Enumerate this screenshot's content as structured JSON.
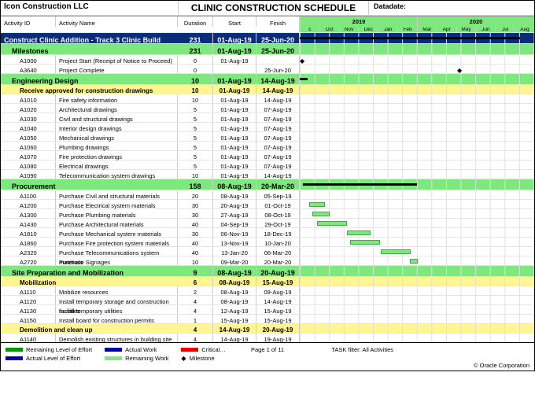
{
  "company": "Icon Construction LLC",
  "title": "CLINIC CONSTRUCTION SCHEDULE",
  "datadate_label": "Datadate:",
  "columns": {
    "id": "Activity ID",
    "name": "Activity Name",
    "dur": "Duration",
    "start": "Start",
    "finish": "Finish"
  },
  "years": [
    "2019",
    "2020"
  ],
  "months": [
    "c",
    "Oct",
    "Nov",
    "Dec",
    "Jan",
    "Feb",
    "Mar",
    "Apr",
    "May",
    "Jun",
    "Jul",
    "Aug"
  ],
  "footer": {
    "legend_remaining_loe": "Remaining Level of Effort",
    "legend_actual_loe": "Actual Level of Effort",
    "legend_actual_work": "Actual Work",
    "legend_remaining_work": "Remaining Work",
    "legend_critical": "Critical…",
    "legend_milestone": "Milestone",
    "page": "Page 1 of 11",
    "filter": "TASK filter: All Activities",
    "copyright": "© Oracle Corporation"
  },
  "rows": [
    {
      "type": "summary-top",
      "name": "Construct Clinic Addition - Track 3 Clinic Build",
      "dur": "231",
      "start": "01-Aug-19",
      "finish": "25-Jun-20",
      "sum": [
        0,
        280
      ]
    },
    {
      "type": "group",
      "name": "Milestones",
      "dur": "231",
      "start": "01-Aug-19",
      "finish": "25-Jun-20",
      "valcls": "cell-green"
    },
    {
      "type": "task",
      "id": "A1000",
      "name": "Project Start (Receipt of Notice to Proceed)",
      "dur": "0",
      "start": "01-Aug-19",
      "finish": "",
      "ms": 0
    },
    {
      "type": "task",
      "id": "A3640",
      "name": "Project Complete",
      "dur": "0",
      "start": "",
      "finish": "25-Jun-20",
      "ms": 200
    },
    {
      "type": "group",
      "name": "Engineering Design",
      "dur": "10",
      "start": "01-Aug-19",
      "finish": "14-Aug-19",
      "valcls": "cell-green",
      "sum": [
        0,
        10
      ]
    },
    {
      "type": "sub",
      "name": "Receive approved for construction drawings",
      "dur": "10",
      "start": "01-Aug-19",
      "finish": "14-Aug-19",
      "valcls": "cell-yellow"
    },
    {
      "type": "task",
      "id": "A1010",
      "name": "Fire safety information",
      "dur": "10",
      "start": "01-Aug-19",
      "finish": "14-Aug-19"
    },
    {
      "type": "task",
      "id": "A1020",
      "name": "Architectural drawings",
      "dur": "5",
      "start": "01-Aug-19",
      "finish": "07-Aug-19"
    },
    {
      "type": "task",
      "id": "A1030",
      "name": "Civil and structural drawings",
      "dur": "5",
      "start": "01-Aug-19",
      "finish": "07-Aug-19"
    },
    {
      "type": "task",
      "id": "A1040",
      "name": "Interior design drawings",
      "dur": "5",
      "start": "01-Aug-19",
      "finish": "07-Aug-19"
    },
    {
      "type": "task",
      "id": "A1050",
      "name": "Mechanical drawings",
      "dur": "5",
      "start": "01-Aug-19",
      "finish": "07-Aug-19"
    },
    {
      "type": "task",
      "id": "A1060",
      "name": "Plumbing drawings",
      "dur": "5",
      "start": "01-Aug-19",
      "finish": "07-Aug-19"
    },
    {
      "type": "task",
      "id": "A1070",
      "name": "Fire protection drawings",
      "dur": "5",
      "start": "01-Aug-19",
      "finish": "07-Aug-19"
    },
    {
      "type": "task",
      "id": "A1080",
      "name": "Electrical drawings",
      "dur": "5",
      "start": "01-Aug-19",
      "finish": "07-Aug-19"
    },
    {
      "type": "task",
      "id": "A1090",
      "name": "Telecommunication system drawings",
      "dur": "10",
      "start": "01-Aug-19",
      "finish": "14-Aug-19"
    },
    {
      "type": "group",
      "name": "Procurement",
      "dur": "158",
      "start": "08-Aug-19",
      "finish": "20-Mar-20",
      "valcls": "cell-green",
      "sum": [
        4,
        145
      ]
    },
    {
      "type": "task",
      "id": "A1100",
      "name": "Purchase Civil and structural materials",
      "dur": "20",
      "start": "08-Aug-19",
      "finish": "05-Sep-19"
    },
    {
      "type": "task",
      "id": "A1200",
      "name": "Purchase Electrical system materials",
      "dur": "30",
      "start": "20-Aug-19",
      "finish": "01-Oct-19",
      "bar": [
        12,
        20
      ]
    },
    {
      "type": "task",
      "id": "A1300",
      "name": "Purchase Plumbing materials",
      "dur": "30",
      "start": "27-Aug-19",
      "finish": "08-Oct-19",
      "bar": [
        16,
        22
      ]
    },
    {
      "type": "task",
      "id": "A1430",
      "name": "Purchase Architectural materials",
      "dur": "40",
      "start": "04-Sep-19",
      "finish": "29-Oct-19",
      "bar": [
        22,
        38
      ]
    },
    {
      "type": "task",
      "id": "A1810",
      "name": "Purchase Mechanical system materials",
      "dur": "30",
      "start": "06-Nov-19",
      "finish": "18-Dec-19",
      "bar": [
        60,
        30
      ]
    },
    {
      "type": "task",
      "id": "A1860",
      "name": "Purchase Fire protection system materials",
      "dur": "40",
      "start": "13-Nov-19",
      "finish": "10-Jan-20",
      "bar": [
        64,
        38
      ]
    },
    {
      "type": "task",
      "id": "A2320",
      "name": "Purchase Telecommunications system materials",
      "dur": "40",
      "start": "13-Jan-20",
      "finish": "06-Mar-20",
      "bar": [
        103,
        38
      ]
    },
    {
      "type": "task",
      "id": "A2720",
      "name": "Purchase Signages",
      "dur": "10",
      "start": "09-Mar-20",
      "finish": "20-Mar-20",
      "bar": [
        140,
        10
      ]
    },
    {
      "type": "group",
      "name": "Site Preparation and Mobilization",
      "dur": "9",
      "start": "08-Aug-19",
      "finish": "20-Aug-19",
      "valcls": "cell-green"
    },
    {
      "type": "sub",
      "name": "Mobilization",
      "dur": "6",
      "start": "08-Aug-19",
      "finish": "15-Aug-19",
      "valcls": "cell-yellow"
    },
    {
      "type": "task",
      "id": "A1110",
      "name": "Mobilize resources",
      "dur": "2",
      "start": "08-Aug-19",
      "finish": "09-Aug-19"
    },
    {
      "type": "task",
      "id": "A1120",
      "name": "Install temporary storage and construction facilities",
      "dur": "4",
      "start": "08-Aug-19",
      "finish": "14-Aug-19"
    },
    {
      "type": "task",
      "id": "A1130",
      "name": "Install temporary utilities",
      "dur": "4",
      "start": "12-Aug-19",
      "finish": "15-Aug-19"
    },
    {
      "type": "task",
      "id": "A1150",
      "name": "Install board for construction permits",
      "dur": "1",
      "start": "15-Aug-19",
      "finish": "15-Aug-19"
    },
    {
      "type": "sub",
      "name": "Demolition and clean up",
      "dur": "4",
      "start": "14-Aug-19",
      "finish": "20-Aug-19",
      "valcls": "cell-yellow"
    },
    {
      "type": "task",
      "id": "A1140",
      "name": "Demolish existing structures in building site",
      "dur": "4",
      "start": "14-Aug-19",
      "finish": "19-Aug-19"
    }
  ]
}
